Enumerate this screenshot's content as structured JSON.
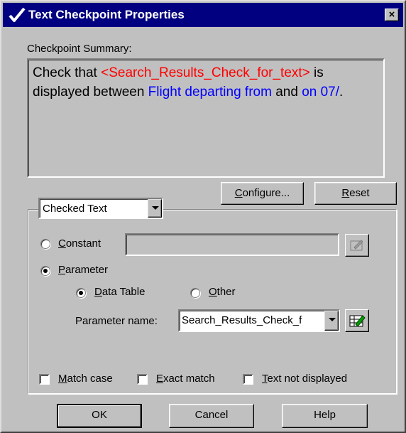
{
  "window": {
    "title": "Text Checkpoint Properties",
    "close_glyph": "×"
  },
  "summary": {
    "label": "Checkpoint Summary:",
    "text_1": "Check that ",
    "checkpoint_name": "<Search_Results_Check_for_text>",
    "text_2": " is",
    "text_3": "displayed between ",
    "text_before": "Flight departing from ",
    "text_4": " and ",
    "text_after": "on 07/",
    "text_5": "."
  },
  "buttons": {
    "configure": {
      "mnemonic": "C",
      "rest": "onfigure..."
    },
    "reset": {
      "mnemonic": "R",
      "rest": "eset"
    },
    "ok": "OK",
    "cancel": "Cancel",
    "help": "Help"
  },
  "group": {
    "selector_value": "Checked Text",
    "constant": {
      "mnemonic": "C",
      "rest": "onstant",
      "value": ""
    },
    "parameter": {
      "mnemonic": "P",
      "rest": "arameter",
      "selected": true
    },
    "data_table": {
      "mnemonic": "D",
      "rest": "ata Table",
      "selected": true
    },
    "other": {
      "mnemonic": "O",
      "rest": "ther",
      "selected": false
    },
    "parameter_name_label": "Parameter name:",
    "parameter_name_value": "Search_Results_Check_f"
  },
  "options": {
    "match_case": {
      "mnemonic": "M",
      "rest": "atch case",
      "checked": false
    },
    "exact_match": {
      "mnemonic": "E",
      "rest": "xact match",
      "checked": false
    },
    "text_not_displayed": {
      "mnemonic": "T",
      "rest": "ext not displayed",
      "checked": false
    }
  },
  "colors": {
    "title_bg": "#000080",
    "highlight_red": "#ff0000",
    "highlight_blue": "#0000ff",
    "face": "#c0c0c0"
  }
}
